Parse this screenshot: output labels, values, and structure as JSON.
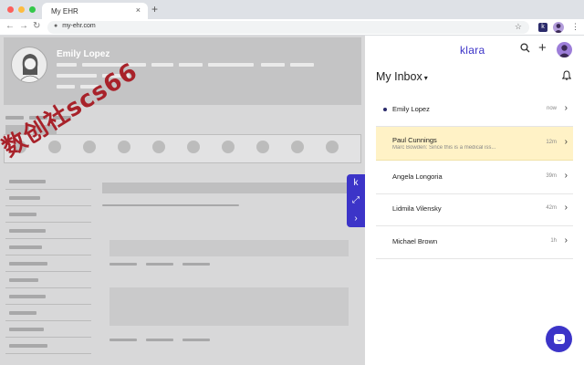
{
  "browser": {
    "tab_title": "My EHR",
    "tab_close": "×",
    "new_tab": "+",
    "back": "←",
    "forward": "→",
    "reload": "↻",
    "url": "my-ehr.com",
    "ext_k": "k",
    "menu": "⋮"
  },
  "ehr": {
    "patient_name": "Emily Lopez",
    "watermark": "数创社scs66"
  },
  "handle": {
    "k_label": "k",
    "expand": "⤢",
    "collapse": "›"
  },
  "klara": {
    "logo": "klara",
    "search_icon": "⚲",
    "add_icon": "+",
    "inbox_title": "My Inbox",
    "inbox_chevron": "▾",
    "bell_icon": "🔔",
    "messages": [
      {
        "name": "Emily Lopez",
        "preview": "",
        "time": "now",
        "unread": true
      },
      {
        "name": "Paul Cunnings",
        "preview": "Marc Bowden: Since this is a medical iss...",
        "time": "12m",
        "unread": false,
        "active": true
      },
      {
        "name": "Angela Longoria",
        "preview": "",
        "time": "39m",
        "unread": false
      },
      {
        "name": "Lidmila Vilensky",
        "preview": "",
        "time": "42m",
        "unread": false
      },
      {
        "name": "Michael Brown",
        "preview": "",
        "time": "1h",
        "unread": false
      }
    ],
    "arrow": "›"
  },
  "colors": {
    "brand": "#3c34c8",
    "active_row": "#fff2c6"
  }
}
